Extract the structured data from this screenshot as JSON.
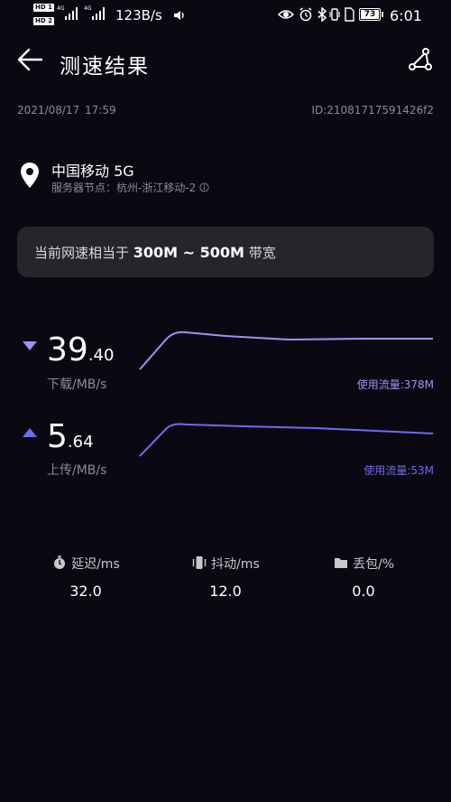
{
  "status_bar": {
    "hd1": "HD 1",
    "hd2": "HD 2",
    "net_tag_1": "4G",
    "net_tag_2": "4G",
    "net_speed": "123B/s",
    "battery": "73",
    "time": "6:01"
  },
  "header": {
    "title": "测速结果"
  },
  "result": {
    "date": "2021/08/17",
    "time": "17:59",
    "id": "ID:21081717591426f2"
  },
  "location": {
    "carrier": "中国移动 5G",
    "node": "服务器节点：杭州-浙江移动-2"
  },
  "banner": {
    "prefix": "当前网速相当于 ",
    "range": "300M ~ 500M",
    "suffix": " 带宽"
  },
  "download": {
    "int": "39",
    "dec": ".40",
    "label": "下载/MB/s",
    "usage": "使用流量:378M",
    "color": "#a98cf2"
  },
  "upload": {
    "int": "5",
    "dec": ".64",
    "label": "上传/MB/s",
    "usage": "使用流量:53M",
    "color": "#6e6cf0"
  },
  "stats": [
    {
      "label": "延迟/ms",
      "value": "32.0",
      "icon": "stopwatch-icon"
    },
    {
      "label": "抖动/ms",
      "value": "12.0",
      "icon": "vibration-icon"
    },
    {
      "label": "丢包/%",
      "value": "0.0",
      "icon": "folder-icon"
    }
  ]
}
